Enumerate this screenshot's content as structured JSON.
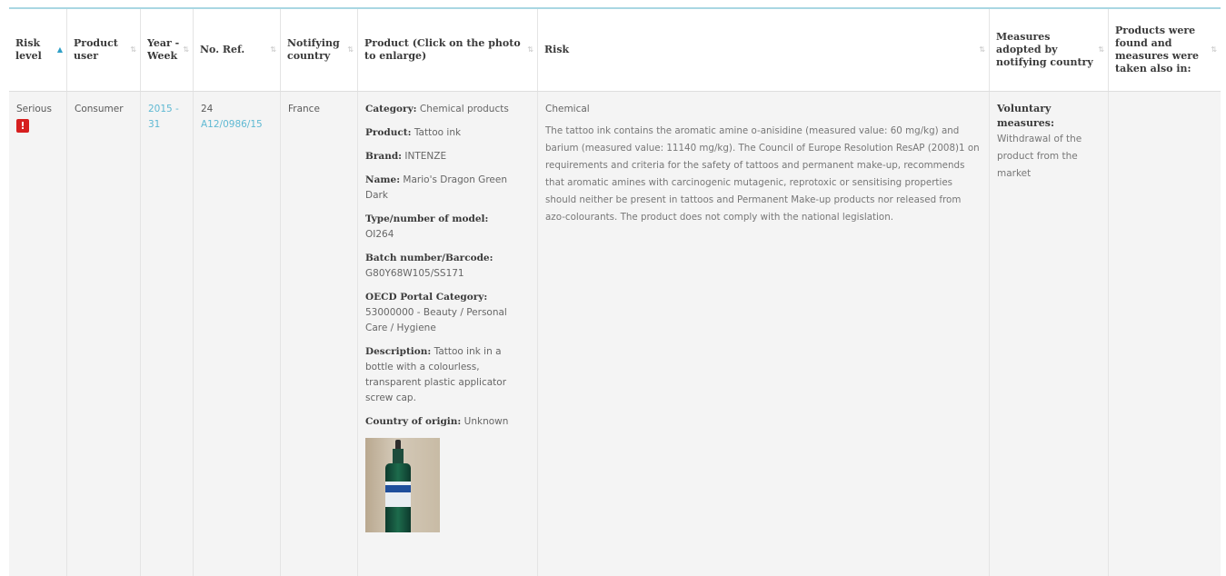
{
  "header": {
    "columns": [
      {
        "label": "Risk level",
        "sort": "active"
      },
      {
        "label": "Product user"
      },
      {
        "label": "Year - Week"
      },
      {
        "label": "No. Ref."
      },
      {
        "label": "Notifying country"
      },
      {
        "label": "Product (Click on the photo to enlarge)"
      },
      {
        "label": "Risk"
      },
      {
        "label": "Measures adopted by notifying country"
      },
      {
        "label": "Products were found and measures were taken also in:"
      }
    ],
    "sort_active_glyph": "▲",
    "sort_glyph": "⇅"
  },
  "row": {
    "risk_level": "Serious",
    "risk_badge": "!",
    "product_user": "Consumer",
    "year_week": "2015 - 31",
    "no_ref_num": "24",
    "no_ref_code": "A12/0986/15",
    "notifying_country": "France",
    "product": {
      "category_label": "Category:",
      "category_value": "Chemical products",
      "product_label": "Product:",
      "product_value": "Tattoo ink",
      "brand_label": "Brand:",
      "brand_value": "INTENZE",
      "name_label": "Name:",
      "name_value": "Mario's Dragon Green Dark",
      "type_label": "Type/number of model:",
      "type_value": "OI264",
      "batch_label": "Batch number/Barcode:",
      "batch_value": "G80Y68W105/SS171",
      "oecd_label": "OECD Portal Category:",
      "oecd_value": "53000000 - Beauty / Personal Care / Hygiene",
      "description_label": "Description:",
      "description_value": "Tattoo ink in a bottle with a colourless, transparent plastic applicator screw cap.",
      "origin_label": "Country of origin:",
      "origin_value": "Unknown"
    },
    "risk": {
      "type": "Chemical",
      "description": "The tattoo ink contains the aromatic amine o-anisidine (measured value: 60 mg/kg) and barium (measured value: 11140 mg/kg). The Council of Europe Resolution ResAP (2008)1 on requirements and criteria for the safety of tattoos and permanent make-up, recommends that aromatic amines with carcinogenic mutagenic, reprotoxic or sensitising properties should neither be present in tattoos and Permanent Make-up products nor released from azo-colourants. The product does not comply with the national legislation."
    },
    "measures": {
      "label": "Voluntary measures:",
      "value": "Withdrawal of the product from the market"
    },
    "also_in": ""
  },
  "colors": {
    "link": "#5fb9d3",
    "risk_badge": "#d61f1f",
    "accent_line": "#a9d7e2"
  }
}
